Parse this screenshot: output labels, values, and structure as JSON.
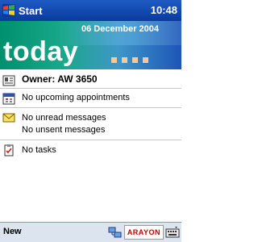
{
  "titlebar": {
    "start_label": "Start",
    "clock": "10:48"
  },
  "banner": {
    "date": "06 December 2004",
    "title": "today"
  },
  "items": {
    "owner": "Owner: AW 3650",
    "appointments": "No upcoming appointments",
    "messages_unread": "No unread messages",
    "messages_unsent": "No unsent messages",
    "tasks": "No tasks"
  },
  "cmdbar": {
    "new_label": "New",
    "logo_text": "ARAYON"
  },
  "colors": {
    "titlebar": "#0a3a9c",
    "accent": "#1aa88a"
  }
}
